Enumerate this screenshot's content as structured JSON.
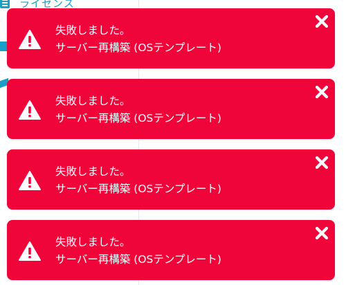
{
  "background": {
    "header_title": "ライセンス"
  },
  "notifications": [
    {
      "title": "失敗しました。",
      "message": "サーバー再構築 (OSテンプレート)"
    },
    {
      "title": "失敗しました。",
      "message": "サーバー再構築 (OSテンプレート)"
    },
    {
      "title": "失敗しました。",
      "message": "サーバー再構築 (OSテンプレート)"
    },
    {
      "title": "失敗しました。",
      "message": "サーバー再構築 (OSテンプレート)"
    }
  ],
  "icons": {
    "status": "warning-triangle-icon",
    "dismiss": "close-icon",
    "menu": "hamburger-menu-icon"
  },
  "colors": {
    "toast_background": "#f0053a",
    "toast_text": "#ffffff",
    "accent": "#1a9fc7"
  }
}
